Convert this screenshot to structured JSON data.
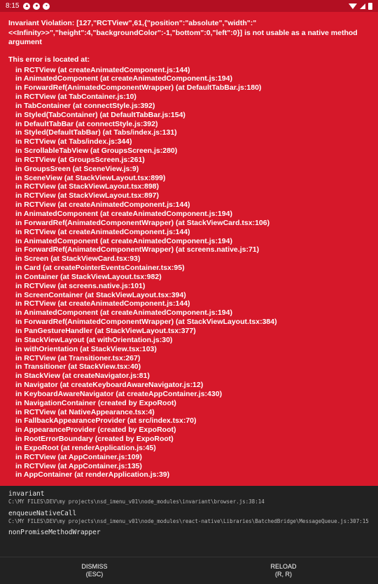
{
  "status_bar": {
    "time": "8:15"
  },
  "error": {
    "message": "Invariant Violation: [127,\"RCTView\",61,{\"position\":\"absolute\",\"width\":\"<<Infinity>>\",\"height\":4,\"backgroundColor\":-1,\"bottom\":0,\"left\":0}] is not usable as a native method argument",
    "located_label": "This error is located at:",
    "stack": [
      "in RCTView (at createAnimatedComponent.js:144)",
      "in AnimatedComponent (at createAnimatedComponent.js:194)",
      "in ForwardRef(AnimatedComponentWrapper) (at DefaultTabBar.js:180)",
      "in RCTView (at TabContainer.js:10)",
      "in TabContainer (at connectStyle.js:392)",
      "in Styled(TabContainer) (at DefaultTabBar.js:154)",
      "in DefaultTabBar (at connectStyle.js:392)",
      "in Styled(DefaultTabBar) (at Tabs/index.js:131)",
      "in RCTView (at Tabs/index.js:344)",
      "in ScrollableTabView (at GroupsScreen.js:280)",
      "in RCTView (at GroupsScreen.js:261)",
      "in GroupsSreen (at SceneView.js:9)",
      "in SceneView (at StackViewLayout.tsx:899)",
      "in RCTView (at StackViewLayout.tsx:898)",
      "in RCTView (at StackViewLayout.tsx:897)",
      "in RCTView (at createAnimatedComponent.js:144)",
      "in AnimatedComponent (at createAnimatedComponent.js:194)",
      "in ForwardRef(AnimatedComponentWrapper) (at StackViewCard.tsx:106)",
      "in RCTView (at createAnimatedComponent.js:144)",
      "in AnimatedComponent (at createAnimatedComponent.js:194)",
      "in ForwardRef(AnimatedComponentWrapper) (at screens.native.js:71)",
      "in Screen (at StackViewCard.tsx:93)",
      "in Card (at createPointerEventsContainer.tsx:95)",
      "in Container (at StackViewLayout.tsx:982)",
      "in RCTView (at screens.native.js:101)",
      "in ScreenContainer (at StackViewLayout.tsx:394)",
      "in RCTView (at createAnimatedComponent.js:144)",
      "in AnimatedComponent (at createAnimatedComponent.js:194)",
      "in ForwardRef(AnimatedComponentWrapper) (at StackViewLayout.tsx:384)",
      "in PanGestureHandler (at StackViewLayout.tsx:377)",
      "in StackViewLayout (at withOrientation.js:30)",
      "in withOrientation (at StackView.tsx:103)",
      "in RCTView (at Transitioner.tsx:267)",
      "in Transitioner (at StackView.tsx:40)",
      "in StackView (at createNavigator.js:81)",
      "in Navigator (at createKeyboardAwareNavigator.js:12)",
      "in KeyboardAwareNavigator (at createAppContainer.js:430)",
      "in NavigationContainer (created by ExpoRoot)",
      "in RCTView (at NativeAppearance.tsx:4)",
      "in FallbackAppearanceProvider (at src/index.tsx:70)",
      "in AppearanceProvider (created by ExpoRoot)",
      "in RootErrorBoundary (created by ExpoRoot)",
      "in ExpoRoot (at renderApplication.js:45)",
      "in RCTView (at AppContainer.js:109)",
      "in RCTView (at AppContainer.js:135)",
      "in AppContainer (at renderApplication.js:39)"
    ]
  },
  "trace": [
    {
      "fn": "invariant",
      "loc": "C:\\MY FILES\\DEV\\my projects\\nsd_imenu_v01\\node_modules\\invariant\\browser.js:38:14"
    },
    {
      "fn": "enqueueNativeCall",
      "loc": "C:\\MY FILES\\DEV\\my projects\\nsd_imenu_v01\\node_modules\\react-native\\Libraries\\BatchedBridge\\MessageQueue.js:307:15"
    },
    {
      "fn": "nonPromiseMethodWrapper",
      "loc": ""
    }
  ],
  "footer": {
    "dismiss_label": "DISMISS",
    "dismiss_hint": "(ESC)",
    "reload_label": "RELOAD",
    "reload_hint": "(R, R)"
  },
  "colors": {
    "background": "#d6182a",
    "statusbar": "#b30f22",
    "footer": "#222222"
  }
}
